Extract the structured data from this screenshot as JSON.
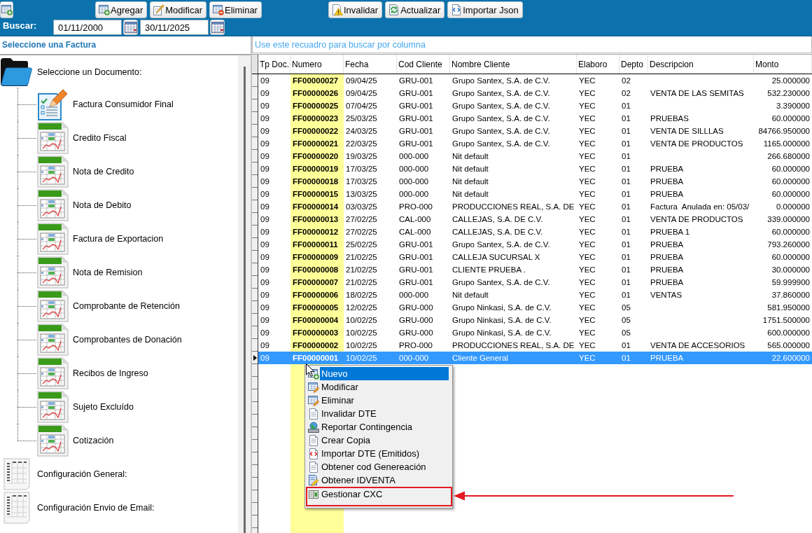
{
  "toolbar": {
    "groups": [
      {
        "buttons": [
          "Agregar",
          "Modificar",
          "Eliminar"
        ]
      },
      {
        "buttons": [
          "Invalidar",
          "Actualizar",
          "Importar Json"
        ]
      }
    ]
  },
  "date_filter": {
    "label": "Buscar:",
    "from": "01/11/2000",
    "to": "30/11/2025"
  },
  "document_panel": {
    "title": "Seleccione una Factura",
    "items": [
      {
        "label": "Seleccione un Documento:",
        "kind": "folder",
        "children": [
          {
            "label": "Factura Consumidor Final",
            "kind": "form"
          },
          {
            "label": "Credito Fiscal",
            "kind": "sheet"
          },
          {
            "label": "Nota de Credito",
            "kind": "sheet"
          },
          {
            "label": "Nota de Debito",
            "kind": "sheet"
          },
          {
            "label": "Factura de Exportacion",
            "kind": "sheet"
          },
          {
            "label": "Nota de Remision",
            "kind": "sheet"
          },
          {
            "label": "Comprobante de Retención",
            "kind": "sheet"
          },
          {
            "label": "Comprobantes de Donación",
            "kind": "sheet"
          },
          {
            "label": "Recibos de Ingreso",
            "kind": "sheet"
          },
          {
            "label": "Sujeto Excluído",
            "kind": "sheet"
          },
          {
            "label": "Cotización",
            "kind": "sheet"
          }
        ]
      },
      {
        "label": "Configuración General:",
        "kind": "settings"
      },
      {
        "label": "Configuración Envio de Email:",
        "kind": "settings"
      }
    ]
  },
  "grid": {
    "search": {
      "placeholder": "Use este recuadro para buscar por columna"
    },
    "columns": [
      {
        "label": "Tp Doc.",
        "highlighted": false
      },
      {
        "label": "Numero",
        "highlighted": true
      },
      {
        "label": "Fecha",
        "highlighted": false
      },
      {
        "label": "Cod Cliente",
        "highlighted": false
      },
      {
        "label": "Nombre Cliente",
        "highlighted": false
      },
      {
        "label": "Elaboro",
        "highlighted": false
      },
      {
        "label": "Depto",
        "highlighted": false
      },
      {
        "label": "Descripcion",
        "highlighted": false
      },
      {
        "label": "Monto",
        "highlighted": false
      }
    ],
    "rows": [
      {
        "tp_doc": "09",
        "numero": "FF00000027",
        "fecha": "09/04/25",
        "cod_cliente": "GRU-001",
        "nombre_cliente": "Grupo Santex, S.A. de C.V.",
        "elaboro": "YEC",
        "depto": "02",
        "monto": "25.000000",
        "selected": false
      },
      {
        "tp_doc": "09",
        "numero": "FF00000026",
        "fecha": "09/04/25",
        "cod_cliente": "GRU-001",
        "nombre_cliente": "Grupo Santex, S.A. de C.V.",
        "elaboro": "YEC",
        "depto": "02",
        "descripcion": "VENTA DE LAS SEMITAS",
        "monto": "532.230000",
        "selected": false
      },
      {
        "tp_doc": "09",
        "numero": "FF00000025",
        "fecha": "07/04/25",
        "cod_cliente": "GRU-001",
        "nombre_cliente": "Grupo Santex, S.A. de C.V.",
        "elaboro": "YEC",
        "depto": "01",
        "monto": "3.390000",
        "selected": false
      },
      {
        "tp_doc": "09",
        "numero": "FF00000023",
        "fecha": "25/03/25",
        "cod_cliente": "GRU-001",
        "nombre_cliente": "Grupo Santex, S.A. de C.V.",
        "elaboro": "YEC",
        "depto": "01",
        "descripcion": "PRUEBAS",
        "monto": "60.000000",
        "selected": false
      },
      {
        "tp_doc": "09",
        "numero": "FF00000022",
        "fecha": "24/03/25",
        "cod_cliente": "GRU-001",
        "nombre_cliente": "Grupo Santex, S.A. de C.V.",
        "elaboro": "YEC",
        "depto": "01",
        "descripcion": "VENTA DE SILLLAS",
        "monto": "84766.950000",
        "selected": false
      },
      {
        "tp_doc": "09",
        "numero": "FF00000021",
        "fecha": "22/03/25",
        "cod_cliente": "GRU-001",
        "nombre_cliente": "Grupo Santex, S.A. de C.V.",
        "elaboro": "YEC",
        "depto": "01",
        "descripcion": "VENTA DE PRODUCTOS",
        "monto": "1165.000000",
        "selected": false
      },
      {
        "tp_doc": "09",
        "numero": "FF00000020",
        "fecha": "19/03/25",
        "cod_cliente": "000-000",
        "nombre_cliente": "Nit default",
        "elaboro": "YEC",
        "depto": "01",
        "monto": "266.680000",
        "selected": false
      },
      {
        "tp_doc": "09",
        "numero": "FF00000019",
        "fecha": "17/03/25",
        "cod_cliente": "000-000",
        "nombre_cliente": "Nit default",
        "elaboro": "YEC",
        "depto": "01",
        "descripcion": "PRUEBA",
        "monto": "60.000000",
        "selected": false
      },
      {
        "tp_doc": "09",
        "numero": "FF00000018",
        "fecha": "17/03/25",
        "cod_cliente": "000-000",
        "nombre_cliente": "Nit default",
        "elaboro": "YEC",
        "depto": "01",
        "descripcion": "PRUEBA",
        "monto": "60.000000",
        "selected": false
      },
      {
        "tp_doc": "09",
        "numero": "FF00000015",
        "fecha": "13/03/25",
        "cod_cliente": "000-000",
        "nombre_cliente": "Nit default",
        "elaboro": "YEC",
        "depto": "01",
        "descripcion": "PRUEBA",
        "monto": "60.000000",
        "selected": false
      },
      {
        "tp_doc": "09",
        "numero": "FF00000014",
        "fecha": "03/03/25",
        "cod_cliente": "PRO-000",
        "nombre_cliente": "PRODUCCIONES REAL, S.A. DE",
        "elaboro": "YEC",
        "depto": "01",
        "descripcion": "Factura  Anulada en: 05/03/",
        "monto": "0.000000",
        "selected": false
      },
      {
        "tp_doc": "09",
        "numero": "FF00000013",
        "fecha": "27/02/25",
        "cod_cliente": "CAL-000",
        "nombre_cliente": "CALLEJAS, S.A. DE C.V.",
        "elaboro": "YEC",
        "depto": "01",
        "descripcion": "VENTA DE PRODUCTOS",
        "monto": "339.000000",
        "selected": false
      },
      {
        "tp_doc": "09",
        "numero": "FF00000012",
        "fecha": "27/02/25",
        "cod_cliente": "CAL-000",
        "nombre_cliente": "CALLEJAS, S.A. DE C.V.",
        "elaboro": "YEC",
        "depto": "01",
        "descripcion": "PRUEBA 1",
        "monto": "60.000000",
        "selected": false
      },
      {
        "tp_doc": "09",
        "numero": "FF00000011",
        "fecha": "25/02/25",
        "cod_cliente": "GRU-001",
        "nombre_cliente": "Grupo Santex, S.A. de C.V.",
        "elaboro": "YEC",
        "depto": "01",
        "descripcion": "PRUEBA",
        "monto": "793.260000",
        "selected": false
      },
      {
        "tp_doc": "09",
        "numero": "FF00000009",
        "fecha": "21/02/25",
        "cod_cliente": "GRU-001",
        "nombre_cliente": "CALLEJA SUCURSAL X",
        "elaboro": "YEC",
        "depto": "01",
        "descripcion": "PRUEBA",
        "monto": "60.000000",
        "selected": false
      },
      {
        "tp_doc": "09",
        "numero": "FF00000008",
        "fecha": "21/02/25",
        "cod_cliente": "GRU-001",
        "nombre_cliente": "CLIENTE PRUEBA .",
        "elaboro": "YEC",
        "depto": "01",
        "descripcion": "PRUEBA",
        "monto": "30.000000",
        "selected": false
      },
      {
        "tp_doc": "09",
        "numero": "FF00000007",
        "fecha": "21/02/25",
        "cod_cliente": "GRU-001",
        "nombre_cliente": "Grupo Santex, S.A. de C.V.",
        "elaboro": "YEC",
        "depto": "01",
        "descripcion": "PRUEBA",
        "monto": "59.999900",
        "selected": false
      },
      {
        "tp_doc": "09",
        "numero": "FF00000006",
        "fecha": "18/02/25",
        "cod_cliente": "000-000",
        "nombre_cliente": "Nit default",
        "elaboro": "YEC",
        "depto": "01",
        "descripcion": "VENTAS",
        "monto": "37.860000",
        "selected": false
      },
      {
        "tp_doc": "09",
        "numero": "FF00000005",
        "fecha": "12/02/25",
        "cod_cliente": "GRU-000",
        "nombre_cliente": "Grupo Ninkasi, S.A. de C.V.",
        "elaboro": "YEC",
        "depto": "05",
        "monto": "581.950000",
        "selected": false
      },
      {
        "tp_doc": "09",
        "numero": "FF00000004",
        "fecha": "10/02/25",
        "cod_cliente": "GRU-000",
        "nombre_cliente": "Grupo Ninkasi, S.A. de C.V.",
        "elaboro": "YEC",
        "depto": "05",
        "monto": "1751.500000",
        "selected": false
      },
      {
        "tp_doc": "09",
        "numero": "FF00000003",
        "fecha": "10/02/25",
        "cod_cliente": "GRU-000",
        "nombre_cliente": "Grupo Ninkasi, S.A. de C.V.",
        "elaboro": "YEC",
        "depto": "05",
        "monto": "600.000000",
        "selected": false
      },
      {
        "tp_doc": "09",
        "numero": "FF00000002",
        "fecha": "10/02/25",
        "cod_cliente": "PRO-000",
        "nombre_cliente": "PRODUCCIONES REAL, S.A. DE",
        "elaboro": "YEC",
        "depto": "01",
        "descripcion": "VENTA DE ACCESORIOS",
        "monto": "565.000000",
        "selected": false
      },
      {
        "tp_doc": "09",
        "numero": "FF00000001",
        "fecha": "10/02/25",
        "cod_cliente": "000-000",
        "nombre_cliente": "Cliente General",
        "elaboro": "YEC",
        "depto": "01",
        "descripcion": "PRUEBA",
        "monto": "22.600000",
        "selected": true
      }
    ]
  },
  "context_menu": {
    "items": [
      {
        "label": "Nuevo",
        "highlighted": true,
        "callout": false
      },
      {
        "label": "Modificar",
        "highlighted": false,
        "callout": false
      },
      {
        "label": "Eliminar",
        "highlighted": false,
        "callout": false
      },
      {
        "label": "Invalidar DTE",
        "highlighted": false,
        "callout": false
      },
      {
        "label": "Reportar Contingencia",
        "highlighted": false,
        "callout": false
      },
      {
        "label": "Crear Copia",
        "highlighted": false,
        "callout": false
      },
      {
        "label": "Importar DTE (Emitidos)",
        "highlighted": false,
        "callout": false
      },
      {
        "label": "Obtener cod Genereación",
        "highlighted": false,
        "callout": false
      },
      {
        "label": "Obtener IDVENTA",
        "highlighted": false,
        "callout": false
      },
      {
        "label": "Gestionar CXC",
        "highlighted": false,
        "callout": true
      }
    ]
  }
}
